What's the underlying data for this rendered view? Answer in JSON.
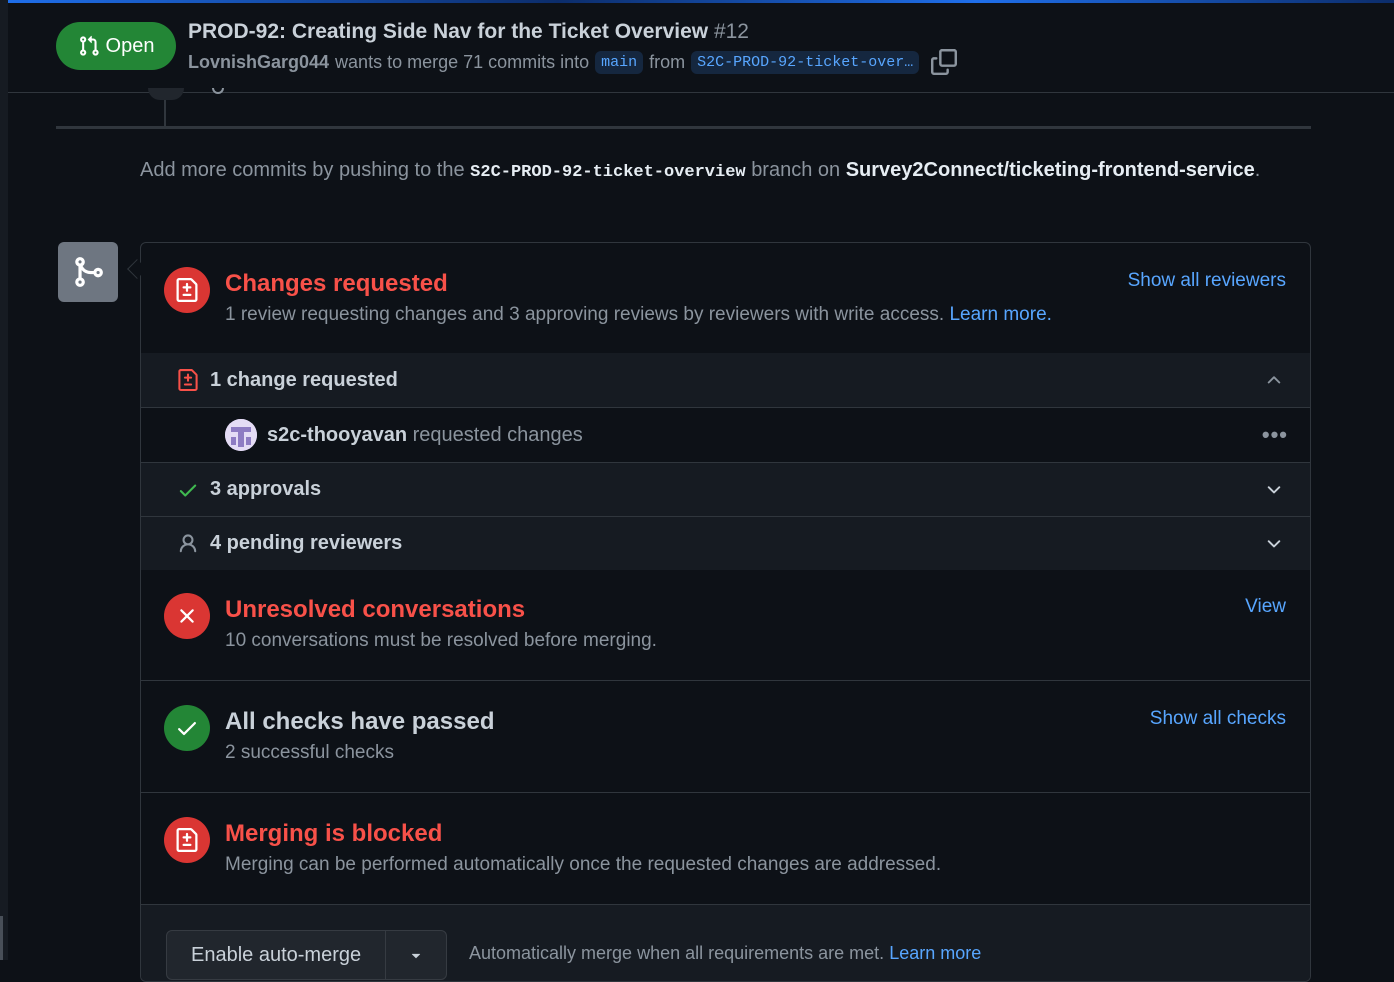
{
  "header": {
    "state_label": "Open",
    "title": "PROD-92: Creating Side Nav for the Ticket Overview",
    "number": "#12",
    "author": "LovnishGarg044",
    "merge_text": "wants to merge 71 commits into",
    "base_branch": "main",
    "from_text": "from",
    "head_branch": "S2C-PROD-92-ticket-over…"
  },
  "add_commits": {
    "prefix": "Add more commits by pushing to the",
    "branch": "S2C-PROD-92-ticket-overview",
    "middle": "branch on",
    "repo": "Survey2Connect/ticketing-frontend-service",
    "suffix": "."
  },
  "changes_requested": {
    "title": "Changes requested",
    "desc": "1 review requesting changes and 3 approving reviews by reviewers with write access.",
    "learn_more": "Learn more.",
    "show_all": "Show all reviewers",
    "rows": {
      "changes_label": "1 change requested",
      "reviewer_name": "s2c-thooyavan",
      "reviewer_action": "requested changes",
      "approvals_label": "3 approvals",
      "pending_label": "4 pending reviewers"
    }
  },
  "unresolved": {
    "title": "Unresolved conversations",
    "desc": "10 conversations must be resolved before merging.",
    "link": "View"
  },
  "checks": {
    "title": "All checks have passed",
    "desc": "2 successful checks",
    "link": "Show all checks"
  },
  "blocked": {
    "title": "Merging is blocked",
    "desc": "Merging can be performed automatically once the requested changes are addressed."
  },
  "auto_merge": {
    "button": "Enable auto-merge",
    "text": "Automatically merge when all requirements are met.",
    "learn_more": "Learn more"
  },
  "colors": {
    "danger": "#f85149",
    "success": "#238636",
    "accent": "#58a6ff",
    "background": "#0d1117"
  }
}
